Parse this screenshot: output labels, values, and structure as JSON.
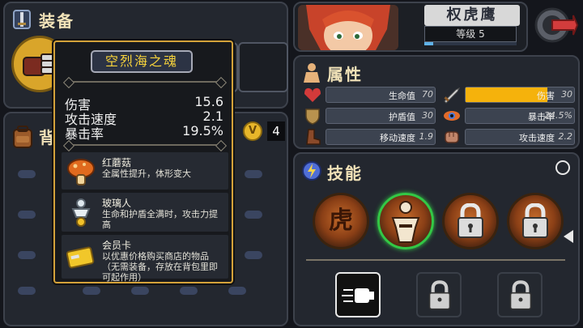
{
  "equip": {
    "title": "装备"
  },
  "bag": {
    "title": "背"
  },
  "gold": {
    "symbol": "V",
    "amount": "4"
  },
  "tooltip": {
    "name": "空烈海之魂",
    "stats": [
      {
        "label": "伤害",
        "value": "15.6"
      },
      {
        "label": "攻击速度",
        "value": "2.1"
      },
      {
        "label": "暴击率",
        "value": "19.5%"
      }
    ],
    "items": [
      {
        "name": "红蘑菇",
        "desc": "全属性提升，体形变大",
        "icon": "red-mushroom-icon"
      },
      {
        "name": "玻璃人",
        "desc": "生命和护盾全满时，攻击力提高",
        "icon": "glass-man-icon"
      },
      {
        "name": "会员卡",
        "desc": "以优惠价格购买商店的物品（无需装备，存放在背包里即可起作用）",
        "icon": "member-card-icon"
      }
    ]
  },
  "character": {
    "name": "权虎鹰",
    "level": "等级 5",
    "xp_fraction": 0.1
  },
  "attributes": {
    "title": "属性",
    "rows": [
      {
        "label": "生命值",
        "value": "70",
        "icon": "heart-icon",
        "color": "#d33a3a",
        "fill": 0
      },
      {
        "label": "伤害",
        "value": "30",
        "icon": "sword-icon",
        "color": "#c9c9c9",
        "fill": 0.75
      },
      {
        "label": "护盾值",
        "value": "30",
        "icon": "shield-icon",
        "color": "#b8924e",
        "fill": 0
      },
      {
        "label": "暴击率",
        "value": "24.5%",
        "icon": "eye-icon",
        "color": "#e26b2a",
        "fill": 0
      },
      {
        "label": "移动速度",
        "value": "1.9",
        "icon": "boot-icon",
        "color": "#8a4a2a",
        "fill": 0
      },
      {
        "label": "攻击速度",
        "value": "2.2",
        "icon": "fist-icon",
        "color": "#c0856a",
        "fill": 0
      }
    ]
  },
  "skills": {
    "title": "技能",
    "tiger_glyph": "虎"
  }
}
